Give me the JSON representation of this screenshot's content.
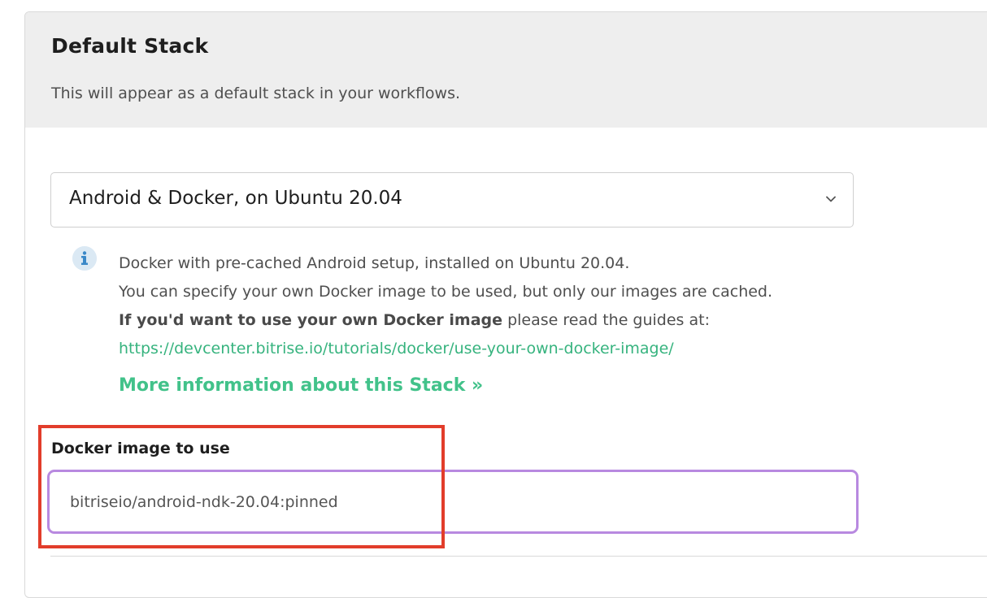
{
  "section": {
    "title": "Default Stack",
    "subtitle": "This will appear as a default stack in your workflows."
  },
  "stack_select": {
    "selected": "Android & Docker, on Ubuntu 20.04",
    "icon": "chevron-down-icon"
  },
  "info": {
    "icon": "info-icon",
    "line1": "Docker with pre-cached Android setup, installed on Ubuntu 20.04.",
    "line2": "You can specify your own Docker image to be used, but only our images are cached.",
    "line3_bold": "If you'd want to use your own Docker image",
    "line3_rest": " please read the guides at:",
    "guide_link": "https://devcenter.bitrise.io/tutorials/docker/use-your-own-docker-image/",
    "more_link": "More information about this Stack »"
  },
  "docker_image": {
    "label": "Docker image to use",
    "value": "bitriseio/android-ndk-20.04:pinned"
  },
  "colors": {
    "link": "#42c28a",
    "input_focus_border": "#b889e0",
    "highlight_annotation": "#e23d2b",
    "header_background": "#eeeeee",
    "info_icon_background": "#dbe9f4",
    "info_icon_foreground": "#3a88c8"
  }
}
